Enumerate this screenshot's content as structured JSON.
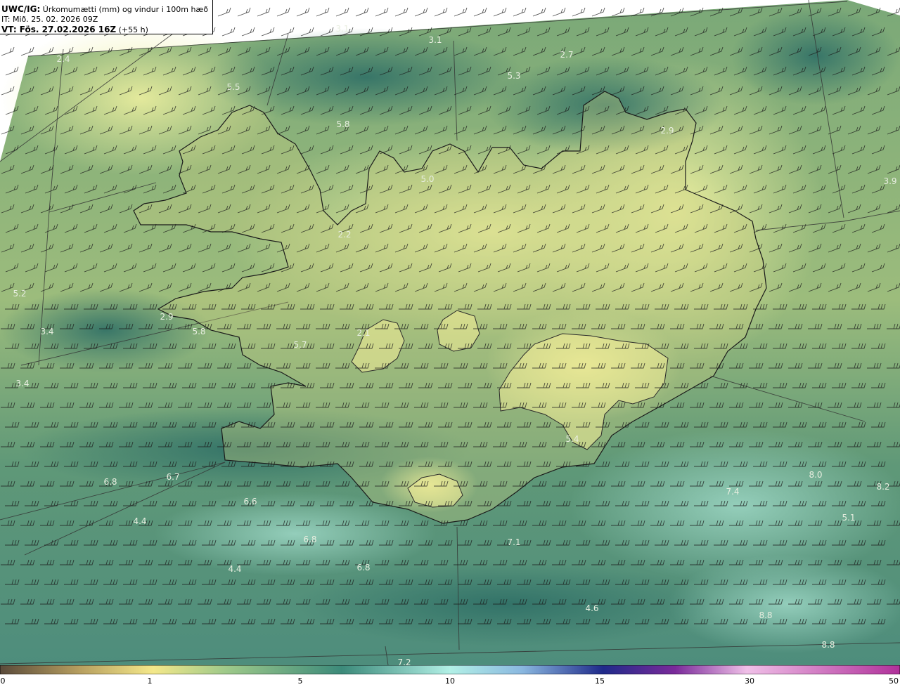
{
  "header": {
    "model_label": "UWC/IG:",
    "title_text": "Úrkomumætti (mm) og vindur i 100m hæð",
    "init_time": "IT: Mið. 25. 02. 2026 09Z",
    "valid_label": "VT: Fös. 27.02.2026 16Z",
    "valid_offset": "(+55 h)"
  },
  "colorbar": {
    "ticks": [
      "0",
      "1",
      "5",
      "10",
      "15",
      "30",
      "50"
    ],
    "colors": [
      "#5a4a3a",
      "#b8a060",
      "#f4e88a",
      "#9fca8a",
      "#3c8a7a",
      "#b2f0e6",
      "#1f2a8a",
      "#7a2a9a",
      "#f0c0e8",
      "#b0309a"
    ]
  },
  "value_labels": [
    "3.1",
    "3.1",
    "2.7",
    "5.3",
    "2.4",
    "5.5",
    "5.8",
    "2.9",
    "5.0",
    "3.9",
    "2.2",
    "5.2",
    "2.9",
    "3.4",
    "5.8",
    "2.1",
    "5.7",
    "3.4",
    "5.4",
    "6.8",
    "6.7",
    "6.6",
    "8.0",
    "8.2",
    "7.4",
    "4.4",
    "5.1",
    "6.8",
    "7.1",
    "6.8",
    "4.4",
    "4.6",
    "8.8",
    "8.8",
    "7.2"
  ],
  "colors": {
    "land_light": "#e8e58a",
    "land_mid": "#b9c978",
    "sea_green": "#6f9e74",
    "sea_dark": "#3f7f6f",
    "coast": "#1a1a1a"
  }
}
